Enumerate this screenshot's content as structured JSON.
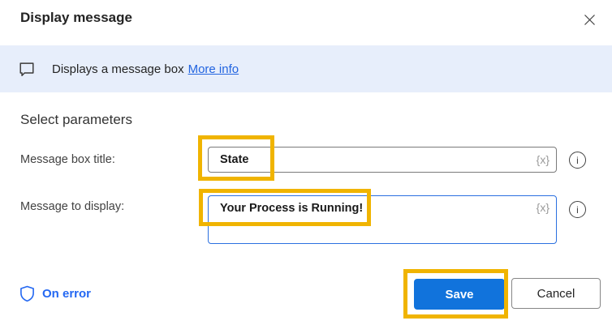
{
  "colors": {
    "annotation_highlight": "#F0B400",
    "primary_button_bg": "#1173DC",
    "link_blue": "#2264E0",
    "on_error_blue": "#2468F2",
    "banner_bg": "#E7EEFB",
    "focused_field_border": "#2B70E0"
  },
  "header": {
    "title": "Display message"
  },
  "banner": {
    "text": "Displays a message box",
    "link_label": "More info"
  },
  "parameters": {
    "heading": "Select parameters",
    "fields": [
      {
        "label": "Message box title:",
        "value": "State",
        "variable_button_label": "{x}"
      },
      {
        "label": "Message to display:",
        "value": "Your Process is Running!",
        "variable_button_label": "{x}"
      }
    ]
  },
  "icons": {
    "info_glyph": "i",
    "close": "x-icon",
    "banner": "message-bubble-icon",
    "on_error": "shield-icon"
  },
  "footer": {
    "on_error_label": "On error",
    "save_label": "Save",
    "cancel_label": "Cancel"
  }
}
